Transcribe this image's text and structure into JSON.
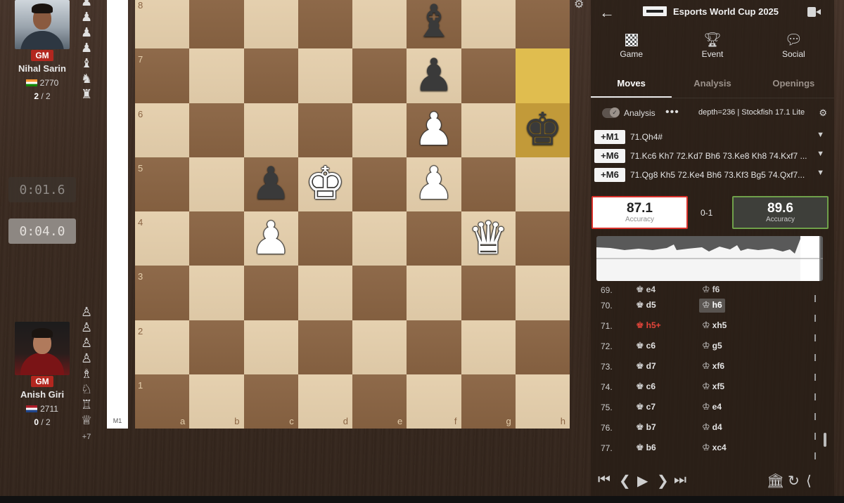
{
  "players": {
    "top": {
      "title": "GM",
      "name": "Nihal Sarin",
      "rating": "2770",
      "score": "2",
      "score_total": "/ 2",
      "captured": [
        "♟",
        "♟",
        "♟",
        "♟",
        "♝",
        "♞",
        "♜"
      ]
    },
    "bottom": {
      "title": "GM",
      "name": "Anish Giri",
      "rating": "2711",
      "score": "0",
      "score_total": "/ 2",
      "captured": [
        "♙",
        "♙",
        "♙",
        "♙",
        "♗",
        "♘",
        "♖",
        "♕"
      ],
      "advantage": "+7"
    }
  },
  "clocks": {
    "first": "0:01.6",
    "second": "0:04.0"
  },
  "eval_bar": {
    "label": "M1"
  },
  "board": {
    "ranks": [
      "8",
      "7",
      "6",
      "5",
      "4",
      "3",
      "2",
      "1"
    ],
    "files": [
      "a",
      "b",
      "c",
      "d",
      "e",
      "f",
      "g",
      "h"
    ],
    "highlighted": [
      "h7",
      "h6"
    ],
    "pieces": [
      {
        "square": "f8",
        "glyph": "♝",
        "color": "b",
        "name": "black-bishop"
      },
      {
        "square": "f7",
        "glyph": "♟",
        "color": "b",
        "name": "black-pawn"
      },
      {
        "square": "f6",
        "glyph": "♟",
        "color": "w",
        "name": "white-pawn"
      },
      {
        "square": "h6",
        "glyph": "♚",
        "color": "b",
        "name": "black-king"
      },
      {
        "square": "c5",
        "glyph": "♟",
        "color": "b",
        "name": "black-pawn"
      },
      {
        "square": "d5",
        "glyph": "♚",
        "color": "w",
        "name": "white-king"
      },
      {
        "square": "f5",
        "glyph": "♟",
        "color": "w",
        "name": "white-pawn"
      },
      {
        "square": "c4",
        "glyph": "♟",
        "color": "w",
        "name": "white-pawn"
      },
      {
        "square": "g4",
        "glyph": "♛",
        "color": "w",
        "name": "white-queen"
      }
    ]
  },
  "header": {
    "event_title": "Esports World Cup 2025"
  },
  "top_tabs": [
    {
      "label": "Game",
      "icon": "board-icon"
    },
    {
      "label": "Event",
      "icon": "trophy-icon"
    },
    {
      "label": "Social",
      "icon": "chat-icon"
    }
  ],
  "sub_tabs": [
    "Moves",
    "Analysis",
    "Openings"
  ],
  "analysis": {
    "label": "Analysis",
    "dots": "•••",
    "depth": "depth=236 | Stockfish 17.1 Lite"
  },
  "lines": [
    {
      "eval": "+M1",
      "moves": "71.Qh4#"
    },
    {
      "eval": "+M6",
      "moves": "71.Kc6 Kh7 72.Kd7 Bh6 73.Ke8 Kh8 74.Kxf7 ..."
    },
    {
      "eval": "+M6",
      "moves": "71.Qg8 Kh5 72.Ke4 Bh6 73.Kf3 Bg5 74.Qxf7..."
    }
  ],
  "accuracy": {
    "white": "87.1",
    "black": "89.6",
    "label": "Accuracy",
    "result": "0-1"
  },
  "moves": [
    {
      "num": "69.",
      "white": "e4",
      "black": "f6",
      "partial": true
    },
    {
      "num": "70.",
      "white": "d5",
      "black": "h6",
      "selected": true
    },
    {
      "num": "71.",
      "white": "h5+",
      "black": "xh5",
      "check": true
    },
    {
      "num": "72.",
      "white": "c6",
      "black": "g5"
    },
    {
      "num": "73.",
      "white": "d7",
      "black": "xf6"
    },
    {
      "num": "74.",
      "white": "c6",
      "black": "xf5"
    },
    {
      "num": "75.",
      "white": "c7",
      "black": "e4"
    },
    {
      "num": "76.",
      "white": "b7",
      "black": "d4"
    },
    {
      "num": "77.",
      "white": "b6",
      "black": "xc4"
    }
  ],
  "colors": {
    "light_square": "#e4ceab",
    "dark_square": "#8a6443",
    "highlight": "#e0bd4f",
    "check_red": "#e4453a",
    "white_accuracy_border": "#d9302a",
    "black_accuracy_border": "#6fa04a"
  }
}
